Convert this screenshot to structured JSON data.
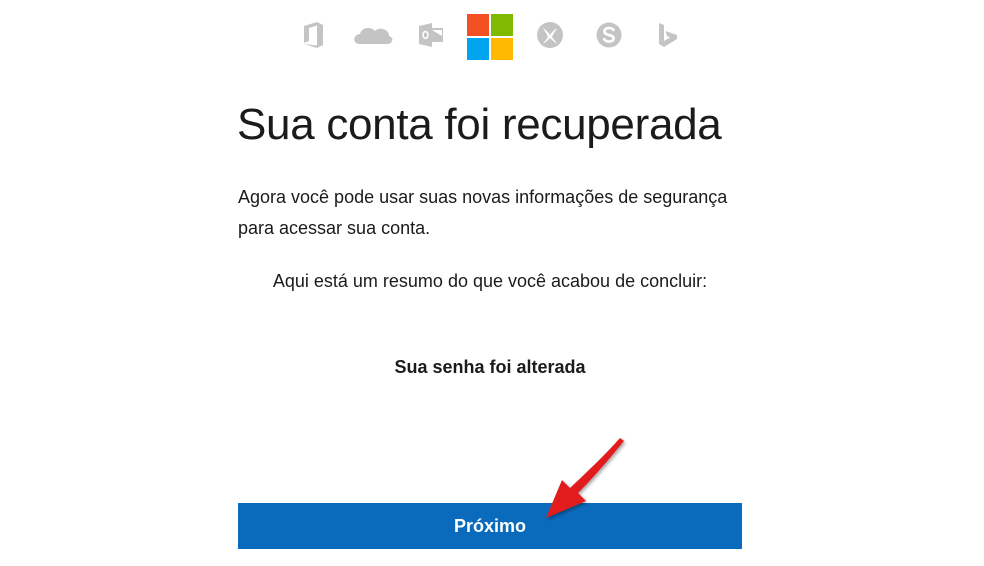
{
  "header": {
    "products": [
      "office-icon",
      "onedrive-icon",
      "outlook-icon",
      "microsoft-logo",
      "xbox-icon",
      "skype-icon",
      "bing-icon"
    ],
    "logo_colors": {
      "red": "#f25022",
      "green": "#7fba00",
      "blue": "#00a4ef",
      "yellow": "#ffb900"
    },
    "icon_color": "#c4c4c4"
  },
  "main": {
    "title": "Sua conta foi recuperada",
    "intro": "Agora você pode usar suas novas informações de segurança para acessar sua conta.",
    "summary_lead": "Aqui está um resumo do que você acabou de concluir:",
    "summary_item": "Sua senha foi alterada"
  },
  "actions": {
    "next_label": "Próximo",
    "next_color": "#0a6bbd"
  },
  "annotation": {
    "arrow_color": "#e21b1b"
  }
}
